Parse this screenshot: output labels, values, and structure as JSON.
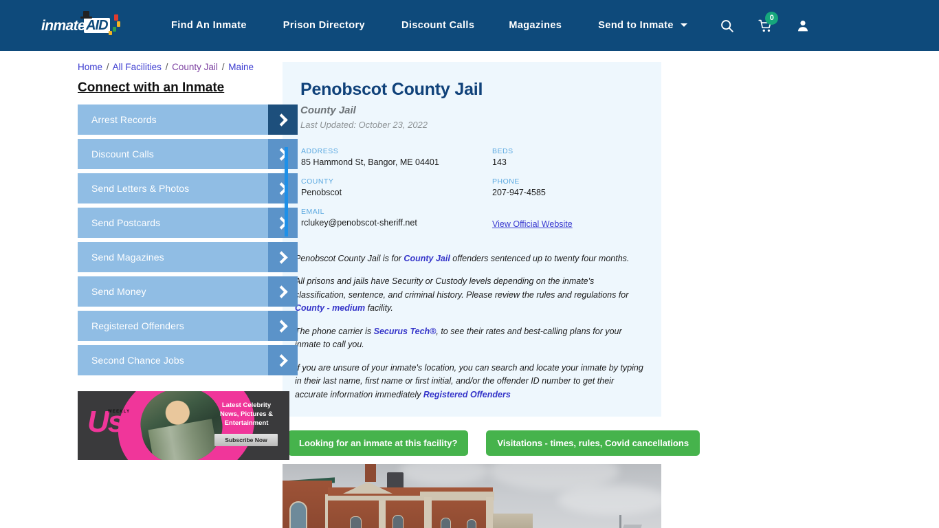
{
  "header": {
    "logo": {
      "text": "inmate",
      "badge": "AID",
      "alt": "inmateAID logo"
    },
    "nav": [
      {
        "label": "Find An Inmate"
      },
      {
        "label": "Prison Directory"
      },
      {
        "label": "Discount Calls"
      },
      {
        "label": "Magazines"
      },
      {
        "label": "Send to Inmate",
        "has_dropdown": true
      }
    ],
    "icons": {
      "search": "search-icon",
      "cart": "shopping-cart-icon",
      "cart_count": "0",
      "account": "user-account-icon"
    },
    "bg_color": "#0e4a7b",
    "badge_color": "#16a77c"
  },
  "breadcrumb": {
    "items": [
      "Home",
      "All Facilities",
      "County Jail",
      "Maine"
    ],
    "separator": "/"
  },
  "sidebar": {
    "heading": "Connect with an Inmate",
    "items": [
      {
        "label": "Arrest Records",
        "active": true
      },
      {
        "label": "Discount Calls",
        "active": false
      },
      {
        "label": "Send Letters & Photos",
        "active": false
      },
      {
        "label": "Send Postcards",
        "active": false
      },
      {
        "label": "Send Magazines",
        "active": false
      },
      {
        "label": "Send Money",
        "active": false
      },
      {
        "label": "Registered Offenders",
        "active": false
      },
      {
        "label": "Second Chance Jobs",
        "active": false
      }
    ],
    "button_color": "#90bde4",
    "arrow_color": "#5b93c9",
    "arrow_active_color": "#1d4f7c"
  },
  "ad": {
    "brand": "Us",
    "brand_sub": "WEEKLY",
    "line1": "Latest Celebrity",
    "line2": "News, Pictures &",
    "line3": "Entertainment",
    "cta": "Subscribe Now"
  },
  "facility": {
    "title": "Penobscot County Jail",
    "subtitle": "County Jail",
    "last_updated": "Last Updated: October 23, 2022",
    "fields": [
      {
        "label": "ADDRESS",
        "value": "85 Hammond St, Bangor, ME 04401"
      },
      {
        "label": "BEDS",
        "value": "143"
      },
      {
        "label": "COUNTY",
        "value": "Penobscot"
      },
      {
        "label": "PHONE",
        "value": "207-947-4585"
      },
      {
        "label": "EMAIL",
        "value": "rclukey@penobscot-sheriff.net"
      }
    ],
    "website_link": "View Official Website",
    "accent_color": "#1e90e8",
    "panel_color": "#eef7fd"
  },
  "paragraphs": {
    "p1_a": "Penobscot County Jail is for ",
    "p1_link": "County Jail",
    "p1_b": " offenders sentenced up to twenty four months.",
    "p2_a": "All prisons and jails have Security or Custody levels depending on the inmate's classification, sentence, and criminal history. Please review the rules and regulations for ",
    "p2_link": "County - medium",
    "p2_b": " facility.",
    "p3_a": "The phone carrier is ",
    "p3_link": "Securus Tech®",
    "p3_b": ", to see their rates and best-calling plans for your inmate to call you.",
    "p4_a": "If you are unsure of your inmate's location, you can search and locate your inmate by typing in their last name, first name or first initial, and/or the offender ID number to get their accurate information immediately ",
    "p4_link": "Registered Offenders"
  },
  "actions": {
    "find_inmate": "Looking for an inmate at this facility?",
    "visitations": "Visitations - times, rules, Covid cancellations",
    "color": "#46b34c"
  },
  "photo": {
    "alt": "Penobscot County Jail brick building exterior"
  }
}
